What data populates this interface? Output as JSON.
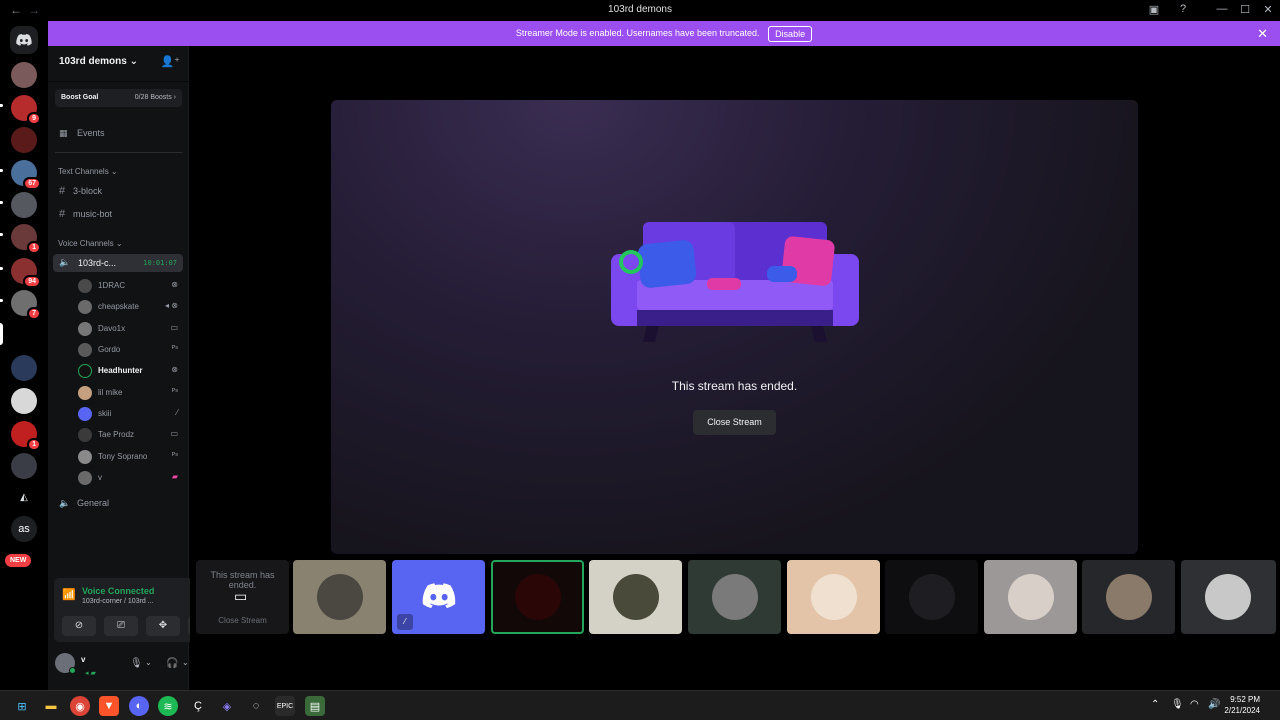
{
  "window": {
    "title": "103rd demons",
    "back": "←",
    "forward": "→",
    "controls": [
      "—",
      "☐",
      "✕"
    ]
  },
  "banner": {
    "text": "Streamer Mode is enabled. Usernames have been truncated.",
    "button": "Disable",
    "close": "✕",
    "color": "#9b4ff0"
  },
  "servers": {
    "badges": [
      "9",
      "67",
      "1",
      "94",
      "7",
      "1"
    ],
    "text_server": "as",
    "new_label": "NEW"
  },
  "guild": {
    "name": "103rd demons",
    "boost_goal": "Boost Goal",
    "boost_count": "0/28 Boosts",
    "events": "Events",
    "text_category": "Text Channels",
    "text_channels": [
      "3-block",
      "music-bot"
    ],
    "voice_category": "Voice Channels",
    "active_voice": {
      "name": "103rd-c...",
      "time": "10:01:07"
    },
    "members": [
      {
        "name": "1DRAC",
        "icon": "xbox-icon"
      },
      {
        "name": "cheapskate",
        "icon": "xbox-icon"
      },
      {
        "name": "Davo1x",
        "icon": "stream-icon"
      },
      {
        "name": "Gordo",
        "icon": "playstation-icon"
      },
      {
        "name": "Headhunter",
        "icon": "xbox-icon"
      },
      {
        "name": "lil mike",
        "icon": "playstation-icon"
      },
      {
        "name": "skiii",
        "icon": "muted-icon"
      },
      {
        "name": "Tae Prodz",
        "icon": "stream-icon"
      },
      {
        "name": "Tony Soprano",
        "icon": "playstation-icon"
      },
      {
        "name": "v",
        "icon": "game-icon"
      }
    ],
    "other_voice": "General"
  },
  "voice_panel": {
    "status": "Voice Connected",
    "location": "103rd-corner / 103rd ...",
    "accent": "#23a55a"
  },
  "user": {
    "name": "v"
  },
  "stream": {
    "message": "This stream has ended.",
    "close_button": "Close Stream"
  },
  "tiles": {
    "ended_text": "This stream has ended.",
    "ended_button": "Close Stream"
  },
  "taskbar": {
    "time": "9:52 PM",
    "date": "2/21/2024"
  }
}
